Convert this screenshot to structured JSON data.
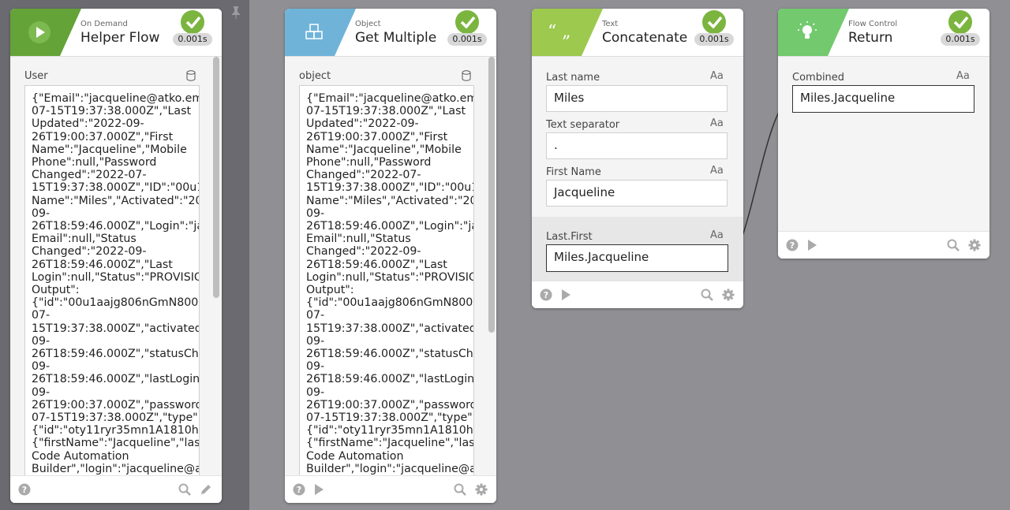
{
  "colors": {
    "canvas": "#8f8f94",
    "on_demand": "#64a338",
    "object": "#6fb3d9",
    "text": "#9cc94e",
    "flow_control": "#73c96e",
    "success": "#7bb53f"
  },
  "cards": {
    "helper_flow": {
      "category": "On Demand",
      "name": "Helper Flow",
      "icon": "play-icon",
      "duration": "0.001s",
      "input_label": "User",
      "input_value": "{\"Email\":\"jacqueline@atko.ema\n07-15T19:37:38.000Z\",\"Last\nUpdated\":\"2022-09-\n26T19:00:37.000Z\",\"First\nName\":\"Jacqueline\",\"Mobile\nPhone\":null,\"Password\nChanged\":\"2022-07-\n15T19:37:38.000Z\",\"ID\":\"00u1aa\nName\":\"Miles\",\"Activated\":\"202\n09-\n26T18:59:46.000Z\",\"Login\":\"jac\nEmail\":null,\"Status\nChanged\":\"2022-09-\n26T18:59:46.000Z\",\"Last\nLogin\":null,\"Status\":\"PROVISIOI\nOutput\":\n{\"id\":\"00u1aajg806nGmN800h\n07-\n15T19:37:38.000Z\",\"activated\":\"\n09-\n26T18:59:46.000Z\",\"statusCha\n09-\n26T18:59:46.000Z\",\"lastLogin\"\n09-\n26T19:00:37.000Z\",\"password(\n07-15T19:37:38.000Z\",\"type\":\n{\"id\":\"oty11ryr35mn1A1810h8\"},\"\n{\"firstName\":\"Jacqueline\",\"lastN\nCode Automation\nBuilder\",\"login\":\"jacqueline@at\n\"\"secondEmail\":null"
    },
    "get_multiple": {
      "category": "Object",
      "name": "Get Multiple",
      "icon": "cubes-icon",
      "duration": "0.001s",
      "input_label": "object",
      "input_value": "{\"Email\":\"jacqueline@atko.ema\n07-15T19:37:38.000Z\",\"Last\nUpdated\":\"2022-09-\n26T19:00:37.000Z\",\"First\nName\":\"Jacqueline\",\"Mobile\nPhone\":null,\"Password\nChanged\":\"2022-07-\n15T19:37:38.000Z\",\"ID\":\"00u1aa\nName\":\"Miles\",\"Activated\":\"202\n09-\n26T18:59:46.000Z\",\"Login\":\"jac\nEmail\":null,\"Status\nChanged\":\"2022-09-\n26T18:59:46.000Z\",\"Last\nLogin\":null,\"Status\":\"PROVISIOI\nOutput\":\n{\"id\":\"00u1aajg806nGmN800h\n07-\n15T19:37:38.000Z\",\"activated\":\"\n09-\n26T18:59:46.000Z\",\"statusCha\n09-\n26T18:59:46.000Z\",\"lastLogin\"\n09-\n26T19:00:37.000Z\",\"password(\n07-15T19:37:38.000Z\",\"type\":\n{\"id\":\"oty11ryr35mn1A1810h8\"},\"\n{\"firstName\":\"Jacqueline\",\"lastN\nCode Automation\nBuilder\",\"login\":\"jacqueline@atl\n\"\"secondEmail\":null"
    },
    "concatenate": {
      "category": "Text",
      "name": "Concatenate",
      "icon": "quotes-icon",
      "duration": "0.001s",
      "fields": [
        {
          "label": "Last name",
          "type_badge": "Aa",
          "value": "Miles"
        },
        {
          "label": "Text separator",
          "type_badge": "Aa",
          "value": "."
        },
        {
          "label": "First Name",
          "type_badge": "Aa",
          "value": "Jacqueline"
        }
      ],
      "output": {
        "label": "Last.First",
        "type_badge": "Aa",
        "value": "Miles.Jacqueline"
      }
    },
    "return": {
      "category": "Flow Control",
      "name": "Return",
      "icon": "lightbulb-icon",
      "duration": "0.001s",
      "field": {
        "label": "Combined",
        "type_badge": "Aa",
        "value": "Miles.Jacqueline"
      }
    }
  }
}
